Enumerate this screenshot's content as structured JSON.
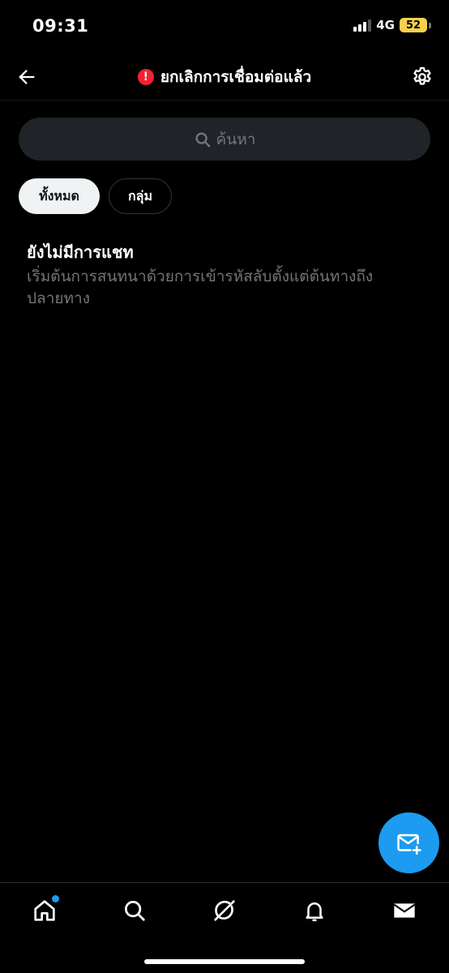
{
  "status_bar": {
    "time": "09:31",
    "network": "4G",
    "battery": "52"
  },
  "header": {
    "title": "ยกเลิกการเชื่อมต่อแล้ว",
    "error_glyph": "!",
    "back_icon": "arrow-left-icon",
    "settings_icon": "gear-icon"
  },
  "search": {
    "placeholder": "ค้นหา"
  },
  "filters": {
    "all_label": "ทั้งหมด",
    "groups_label": "กลุ่ม",
    "selected": "ทั้งหมด"
  },
  "empty_state": {
    "title": "ยังไม่มีการแชท",
    "description": "เริ่มต้นการสนทนาด้วยการเข้ารหัสลับตั้งแต่ต้นทางถึงปลายทาง"
  },
  "colors": {
    "accent": "#1d9bf0",
    "error": "#f4212e",
    "background": "#000000",
    "muted_text": "#71767b"
  },
  "bottom_nav": {
    "items": [
      "home-icon",
      "search-icon",
      "grok-icon",
      "bell-icon",
      "mail-icon"
    ],
    "active": "mail-icon"
  }
}
